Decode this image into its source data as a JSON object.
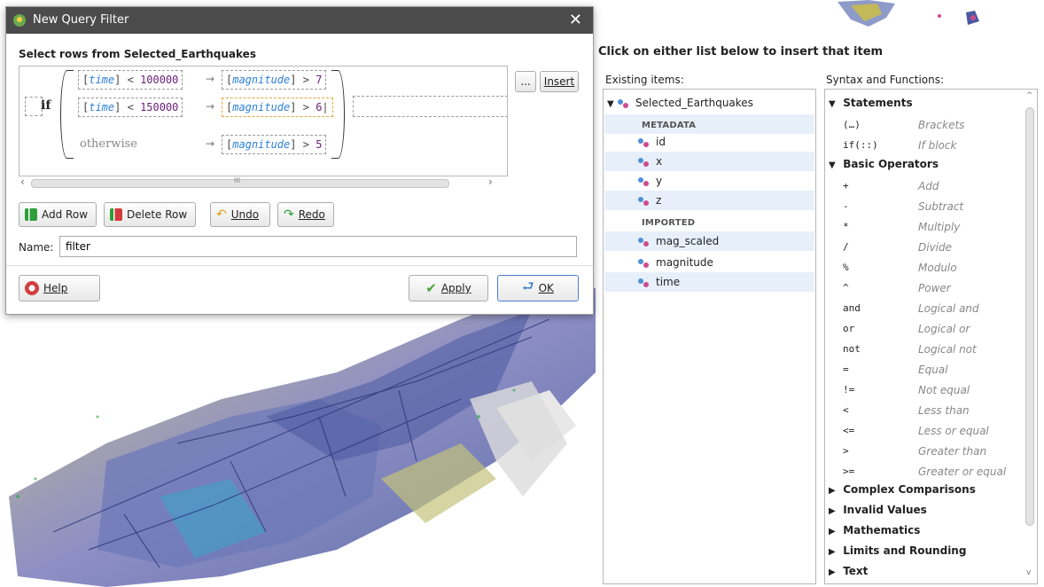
{
  "dialog": {
    "title": "New Query Filter",
    "expression_heading": "Select rows from Selected_Earthquakes",
    "if_keyword": "if",
    "otherwise_keyword": "otherwise",
    "rows": [
      {
        "cond_field": "time",
        "cond_op": " < ",
        "cond_value": "100000",
        "res_field": "magnitude",
        "res_op": " > ",
        "res_value": "7"
      },
      {
        "cond_field": "time",
        "cond_op": " < ",
        "cond_value": "150000",
        "res_field": "magnitude",
        "res_op": " > ",
        "res_value": "6"
      },
      {
        "res_field": "magnitude",
        "res_op": " > ",
        "res_value": "5"
      }
    ],
    "arrow": "→",
    "ellipsis_label": "...",
    "insert_label": "Insert",
    "scroll_grip": "III",
    "add_row_label": "Add Row",
    "delete_row_label": "Delete Row",
    "undo_label": "Undo",
    "redo_label": "Redo",
    "name_label": "Name:",
    "name_value": "filter",
    "help_label": "Help",
    "apply_label": "Apply",
    "ok_label": "OK"
  },
  "right_panel": {
    "heading": "Click on either list below to insert that item",
    "existing_label": "Existing items:",
    "syntax_label": "Syntax and Functions:",
    "existing": {
      "root": "Selected_Earthquakes",
      "groups": [
        {
          "header": "METADATA",
          "items": [
            "id",
            "x",
            "y",
            "z"
          ]
        },
        {
          "header": "IMPORTED",
          "items": [
            "mag_scaled",
            "magnitude",
            "time"
          ]
        }
      ]
    },
    "syntax": {
      "statements": {
        "label": "Statements",
        "items": [
          {
            "sym": "(…)",
            "desc": "Brackets"
          },
          {
            "sym": "if(::)",
            "desc": "If block"
          }
        ]
      },
      "basic_operators": {
        "label": "Basic Operators",
        "items": [
          {
            "sym": "+",
            "desc": "Add"
          },
          {
            "sym": "-",
            "desc": "Subtract"
          },
          {
            "sym": "*",
            "desc": "Multiply"
          },
          {
            "sym": "/",
            "desc": "Divide"
          },
          {
            "sym": "%",
            "desc": "Modulo"
          },
          {
            "sym": "^",
            "desc": "Power"
          },
          {
            "sym": "and",
            "desc": "Logical and"
          },
          {
            "sym": "or",
            "desc": "Logical or"
          },
          {
            "sym": "not",
            "desc": "Logical not"
          },
          {
            "sym": "=",
            "desc": "Equal"
          },
          {
            "sym": "!=",
            "desc": "Not equal"
          },
          {
            "sym": "<",
            "desc": "Less than"
          },
          {
            "sym": "<=",
            "desc": "Less or equal"
          },
          {
            "sym": ">",
            "desc": "Greater than"
          },
          {
            "sym": ">=",
            "desc": "Greater or equal"
          }
        ]
      },
      "collapsed": [
        "Complex Comparisons",
        "Invalid Values",
        "Mathematics",
        "Limits and Rounding",
        "Text"
      ]
    }
  },
  "colors": {
    "field": "#2d7fd6",
    "number": "#6b1f7a",
    "row_highlight": "#e7f0fa",
    "titlebar": "#4b4b4b"
  }
}
